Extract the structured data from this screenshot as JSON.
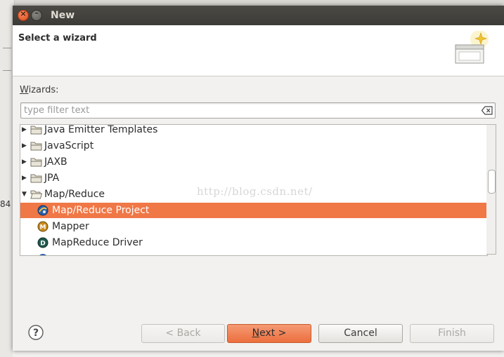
{
  "background": {
    "side_text": "84 ("
  },
  "dialog": {
    "title": "New",
    "header_title": "Select a wizard",
    "wizards_label_prefix": "W",
    "wizards_label_rest": "izards:",
    "filter_placeholder": "type filter text",
    "tree": [
      {
        "label": "Java Emitter Templates",
        "expanded": false,
        "kind": "folder"
      },
      {
        "label": "JavaScript",
        "expanded": false,
        "kind": "folder"
      },
      {
        "label": "JAXB",
        "expanded": false,
        "kind": "folder"
      },
      {
        "label": "JPA",
        "expanded": false,
        "kind": "folder"
      },
      {
        "label": "Map/Reduce",
        "expanded": true,
        "kind": "folder"
      }
    ],
    "children": [
      {
        "label": "Map/Reduce Project",
        "selected": true,
        "icon": "mapreduce-project-icon"
      },
      {
        "label": "Mapper",
        "selected": false,
        "icon": "mapper-icon"
      },
      {
        "label": "MapReduce Driver",
        "selected": false,
        "icon": "driver-icon"
      }
    ],
    "watermark": "http://blog.csdn.net/",
    "buttons": {
      "back": "< Back",
      "next_mnemonic": "N",
      "next_rest": "ext >",
      "cancel": "Cancel",
      "finish": "Finish"
    }
  },
  "colors": {
    "selection": "#f07746",
    "titlebar": "#3c3b37",
    "primary_button": "#ec6f3e"
  }
}
